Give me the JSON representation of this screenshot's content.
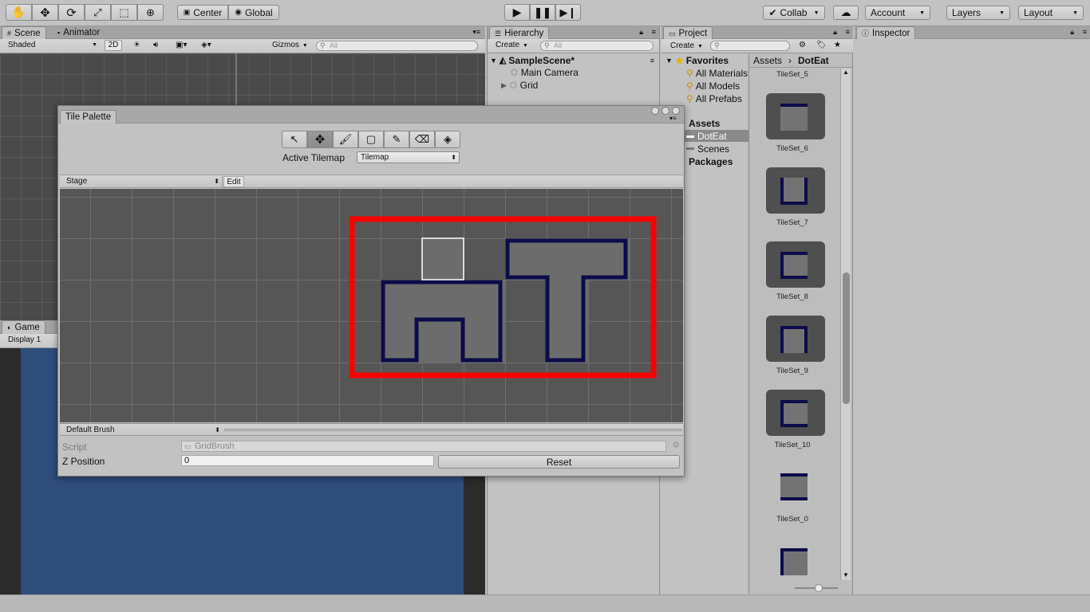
{
  "toolbar": {
    "pivot_label": "Center",
    "space_label": "Global",
    "collab_label": "Collab",
    "account_label": "Account",
    "layers_label": "Layers",
    "layout_label": "Layout"
  },
  "scene": {
    "tab_scene": "Scene",
    "tab_animator": "Animator",
    "shading": "Shaded",
    "mode_2d": "2D",
    "gizmos": "Gizmos",
    "search_placeholder": "All"
  },
  "game": {
    "tab_game": "Game",
    "display": "Display 1"
  },
  "hierarchy": {
    "tab": "Hierarchy",
    "create": "Create",
    "search_placeholder": "All",
    "scene_name": "SampleScene*",
    "items": [
      "Main Camera",
      "Grid"
    ]
  },
  "project": {
    "tab": "Project",
    "create": "Create",
    "favorites": "Favorites",
    "favorite_items": [
      "All Materials",
      "All Models",
      "All Prefabs"
    ],
    "assets": "Assets",
    "asset_folders": [
      "DotEat",
      "Scenes"
    ],
    "packages": "Packages",
    "breadcrumb": [
      "Assets",
      "DotEat"
    ],
    "tiles": [
      "TileSet_5",
      "TileSet_6",
      "TileSet_7",
      "TileSet_8",
      "TileSet_9",
      "TileSet_10",
      "TileSet_0"
    ]
  },
  "inspector": {
    "tab": "Inspector"
  },
  "tile_palette": {
    "title": "Tile Palette",
    "active_tilemap_label": "Active Tilemap",
    "active_tilemap_value": "Tilemap",
    "palette_name": "Stage",
    "edit_label": "Edit",
    "brush": "Default Brush",
    "script_label": "Script",
    "script_value": "GridBrush",
    "zpos_label": "Z Position",
    "zpos_value": "0",
    "reset_label": "Reset"
  },
  "colors": {
    "highlight": "#ff0000",
    "tile_outline": "#0c0c4a",
    "game_bg": "#2e4d7a"
  }
}
